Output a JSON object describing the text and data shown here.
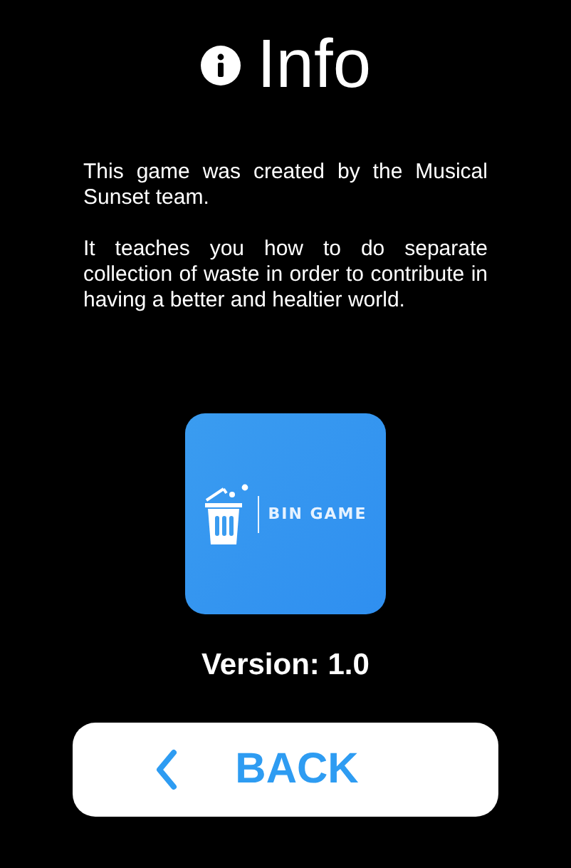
{
  "title": "Info",
  "paragraphs": [
    "This game was created by the Musical Sunset team.",
    "It teaches you how to do separate collection of waste in order to contribute in having a better and healtier world."
  ],
  "logo": {
    "text": "BIN GAME"
  },
  "version": "Version: 1.0",
  "back_button": {
    "label": "BACK"
  }
}
